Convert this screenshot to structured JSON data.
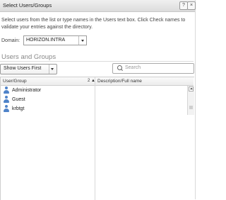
{
  "dialog": {
    "title": "Select Users/Groups",
    "help_glyph": "?",
    "close_glyph": "×",
    "instructions": "Select users from the list or type names in the Users text box. Click Check names to validate your entries against the directory.",
    "domain_label": "Domain:",
    "domain_value": "HORIZON.INTRA"
  },
  "section": {
    "title": "Users and Groups",
    "filter_value": "Show Users First",
    "search_placeholder": "Search"
  },
  "table": {
    "columns": [
      {
        "label": "User/Group"
      },
      {
        "label": "Description/Full name"
      }
    ],
    "sort_indicator": "2 ▲",
    "rows": [
      {
        "name": "Administrator",
        "description": ""
      },
      {
        "name": "Guest",
        "description": ""
      },
      {
        "name": "krbtgt",
        "description": ""
      }
    ]
  },
  "icons": {
    "row_icon": "user-icon",
    "search": "search-icon"
  },
  "colors": {
    "user_icon": "#4f83c9",
    "section_title": "#888888"
  }
}
